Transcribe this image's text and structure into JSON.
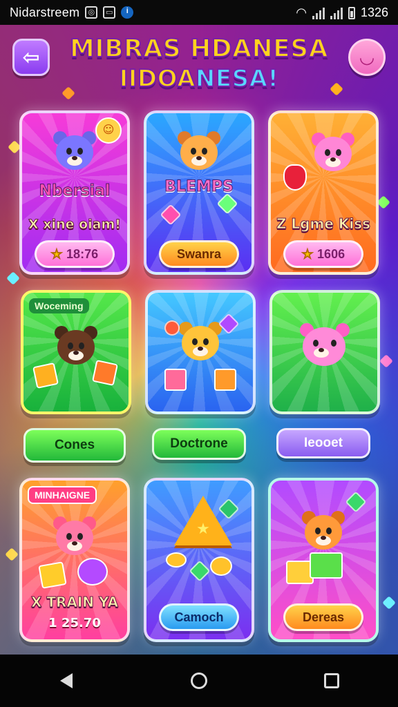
{
  "status_bar": {
    "app_name": "Nidarstreem",
    "time": "1326",
    "icons": [
      "media-icon",
      "cast-icon",
      "info-icon",
      "wifi-icon",
      "signal-icon",
      "signal-icon",
      "battery-icon"
    ]
  },
  "header": {
    "title_line1": "MIBRAS HDANESA",
    "title_line2_a": "IIDOA",
    "title_line2_b": "NESA!",
    "back_icon": "back-arrow-icon",
    "profile_icon": "face-icon"
  },
  "cards": {
    "c1": {
      "banner": "Nbersial",
      "caption": "X xine oiam!",
      "price": "18:76",
      "icon": "star-icon"
    },
    "c2": {
      "banner": "BLEMPS",
      "button": "Swanra"
    },
    "c3": {
      "caption": "Z Lgme Kiss",
      "price": "1606",
      "icon": "star-icon"
    },
    "c4": {
      "tag": "Woceming"
    },
    "c5": {},
    "c6": {},
    "c7": {
      "tag": "MINHAIGNE",
      "caption": "X TRAIN YA",
      "price": "1 25.70"
    },
    "c8": {
      "button": "Camoch"
    },
    "c9": {
      "button": "Dereas"
    }
  },
  "row_buttons": {
    "b1": "Cones",
    "b2": "Doctrone",
    "b3": "Ieooet"
  },
  "colors": {
    "title_yellow": "#ffd21f",
    "title_cyan": "#5ad7ff",
    "accent_pink": "#ff3d9a",
    "accent_green": "#22b83a"
  },
  "nav": {
    "back": "nav-back-icon",
    "home": "nav-home-icon",
    "recent": "nav-recent-icon"
  }
}
